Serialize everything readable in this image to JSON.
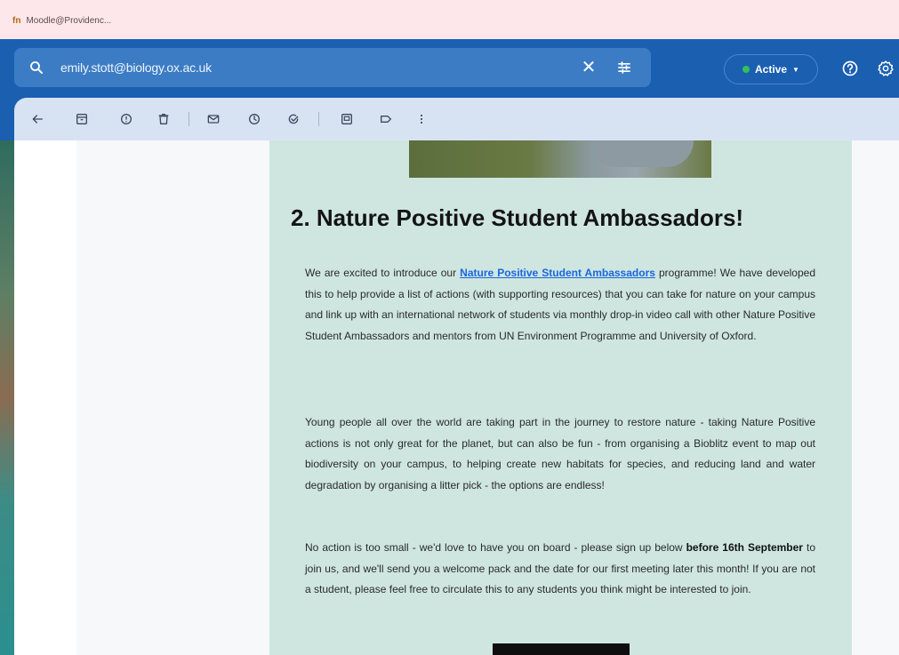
{
  "browser": {
    "tab_title": "Moodle@Providenc...",
    "tab_favicon": "fn"
  },
  "header": {
    "search_value": "emily.stott@biology.ox.ac.uk",
    "status_label": "Active",
    "status_color": "#33c05a"
  },
  "toolbar": {
    "icons": [
      "back-arrow-icon",
      "archive-icon",
      "report-spam-icon",
      "delete-icon",
      "mark-unread-icon",
      "snooze-icon",
      "add-task-icon",
      "move-to-icon",
      "label-icon",
      "more-options-icon"
    ]
  },
  "email": {
    "headline": "2. Nature Positive Student Ambassadors!",
    "p1": {
      "before_link": "We are excited to introduce our ",
      "link": "Nature Positive Student Ambassadors",
      "after_link": " programme! We have developed this to help provide a list of actions (with supporting resources) that you can take for nature on your campus and link up with an international network of students via monthly drop-in video call with other Nature Positive Student Ambassadors and mentors from UN Environment Programme and University of Oxford."
    },
    "p2": "Young people all over the world are taking part in the journey to restore nature - taking Nature Positive actions is not only great for the planet, but can also be fun - from organising a Bioblitz event to map out biodiversity on your campus, to helping create new habitats for species, and reducing land and water degradation by organising a litter pick - the options are endless!",
    "p3": {
      "before_bold": "No action is too small - we'd love to have you on board - please sign up below ",
      "bold": "before 16th September",
      "after_bold": " to join us, and we'll send you a welcome pack and the date for our first meeting later this month! If you are not a student, please feel free to circulate this to any students you think might be interested to join."
    }
  },
  "colors": {
    "header_bg": "#1b5fb1",
    "email_bg": "#cfe6e0",
    "link": "#1a66e0"
  }
}
